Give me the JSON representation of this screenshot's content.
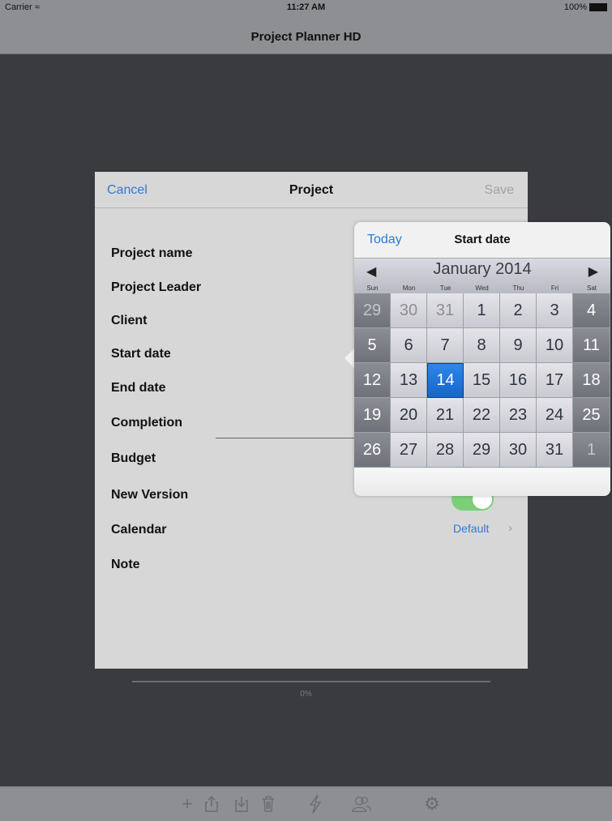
{
  "status_bar": {
    "carrier": "Carrier",
    "time": "11:27 AM",
    "battery": "100%"
  },
  "nav": {
    "title": "Project Planner HD"
  },
  "modal": {
    "cancel": "Cancel",
    "title": "Project",
    "save": "Save",
    "fields": [
      "Project name",
      "Project Leader",
      "Client",
      "Start date",
      "End date",
      "Completion",
      "Budget",
      "New Version",
      "Calendar",
      "Note"
    ],
    "calendar_value": "Default",
    "new_version_toggle": true
  },
  "progress": {
    "label": "0%"
  },
  "popover": {
    "today": "Today",
    "title": "Start date",
    "month": "January 2014",
    "weekdays": [
      "Sun",
      "Mon",
      "Tue",
      "Wed",
      "Thu",
      "Fri",
      "Sat"
    ],
    "weeks": [
      [
        "29",
        "30",
        "31",
        "1",
        "2",
        "3",
        "4"
      ],
      [
        "5",
        "6",
        "7",
        "8",
        "9",
        "10",
        "11"
      ],
      [
        "12",
        "13",
        "14",
        "15",
        "16",
        "17",
        "18"
      ],
      [
        "19",
        "20",
        "21",
        "22",
        "23",
        "24",
        "25"
      ],
      [
        "26",
        "27",
        "28",
        "29",
        "30",
        "31",
        "1"
      ]
    ],
    "selected": "14"
  },
  "toolbar": {
    "icons": [
      "plus-icon",
      "share-icon",
      "import-icon",
      "trash-icon",
      "flash-icon",
      "people-icon",
      "gear-icon"
    ]
  }
}
